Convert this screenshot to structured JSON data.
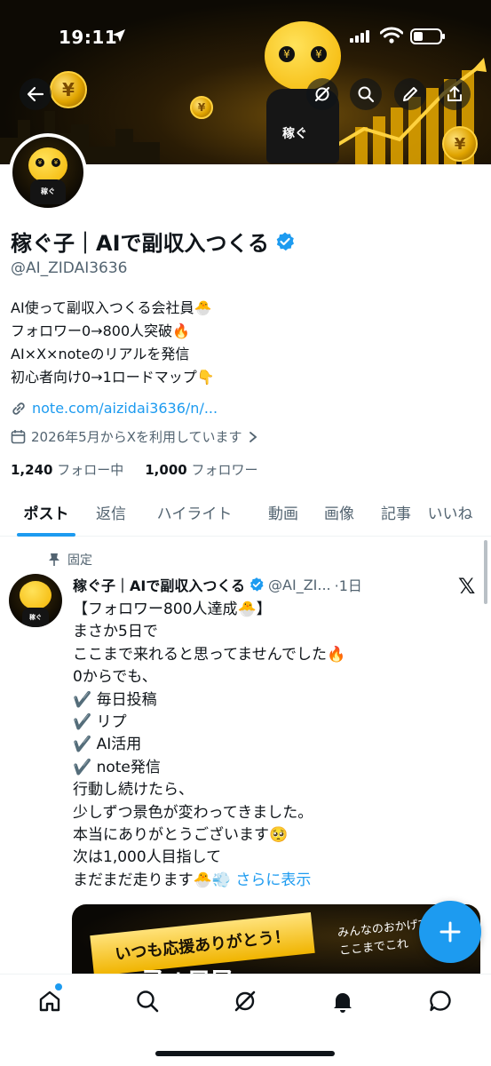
{
  "status_bar": {
    "time": "19:11"
  },
  "banner": {
    "coin_symbol": "¥",
    "shirt_text": "稼ぐ"
  },
  "profile": {
    "display_name": "稼ぐ子｜AIで副収入つくる",
    "handle": "@AI_ZIDAI3636",
    "bio": "AI使って副収入つくる会社員🐣\nフォロワー0→800人突破🔥\nAI×X×noteのリアルを発信\n初心者向け0→1ロードマップ👇",
    "link": "note.com/aizidai3636/n/...",
    "joined": "2026年5月からXを利用しています",
    "following_count": "1,240",
    "following_label": "フォロー中",
    "followers_count": "1,000",
    "followers_label": "フォロワー",
    "avatar_text": "稼ぐ"
  },
  "tabs": [
    {
      "label": "ポスト",
      "active": true
    },
    {
      "label": "返信",
      "active": false
    },
    {
      "label": "ハイライト",
      "active": false
    },
    {
      "label": "動画",
      "active": false
    },
    {
      "label": "画像",
      "active": false
    },
    {
      "label": "記事",
      "active": false
    },
    {
      "label": "いいね",
      "active": false
    }
  ],
  "post": {
    "pinned_label": "固定",
    "author_name": "稼ぐ子｜AIで副収入つくる",
    "author_handle": "@AI_ZI...",
    "time_ago": "·1日",
    "body": "【フォロワー800人達成🐣】\nまさか5日で\nここまで来れると思ってませんでした🔥\n0からでも、\n✔️ 毎日投稿\n✔️ リプ\n✔️ AI活用\n✔️ note発信\n行動し続けたら、\n少しずつ景色が変わってきました。\n本当にありがとうございます🥺\n次は1,000人目指して\nまだまだ走ります🐣💨 ",
    "show_more": "さらに表示",
    "media": {
      "ribbon_text": "いつも応援ありがとう！",
      "side_text": "みんなのおかげで\nここまでこれ",
      "big_text": "フォロワー"
    }
  },
  "colors": {
    "accent": "#1d9bf0",
    "text": "#0f1419",
    "muted": "#536471"
  },
  "icons": {
    "back": "back-arrow-icon",
    "grok": "grok-icon",
    "search": "search-icon",
    "edit": "pencil-icon",
    "share": "share-icon",
    "verified": "verified-badge-icon",
    "link": "link-icon",
    "calendar": "calendar-icon",
    "pin": "pin-icon",
    "compose": "plus-icon",
    "home": "home-icon",
    "notifications": "bell-icon",
    "messages": "chat-icon"
  }
}
